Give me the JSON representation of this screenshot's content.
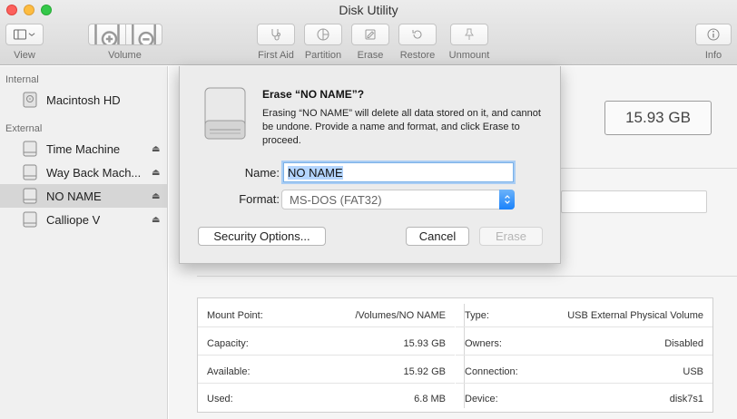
{
  "window": {
    "title": "Disk Utility"
  },
  "toolbar": {
    "view_label": "View",
    "volume_label": "Volume",
    "first_aid_label": "First Aid",
    "partition_label": "Partition",
    "erase_label": "Erase",
    "restore_label": "Restore",
    "unmount_label": "Unmount",
    "info_label": "Info"
  },
  "sidebar": {
    "sections": [
      {
        "heading": "Internal",
        "items": [
          {
            "label": "Macintosh HD",
            "eject": false
          }
        ]
      },
      {
        "heading": "External",
        "items": [
          {
            "label": "Time Machine",
            "eject": true
          },
          {
            "label": "Way Back Mach...",
            "eject": true
          },
          {
            "label": "NO NAME",
            "eject": true,
            "selected": true
          },
          {
            "label": "Calliope V",
            "eject": true
          }
        ]
      }
    ],
    "eject_glyph": "⏏"
  },
  "main": {
    "capacity": "15.93 GB",
    "info": {
      "left": [
        {
          "key": "Mount Point:",
          "value": "/Volumes/NO NAME"
        },
        {
          "key": "Capacity:",
          "value": "15.93 GB"
        },
        {
          "key": "Available:",
          "value": "15.92 GB"
        },
        {
          "key": "Used:",
          "value": "6.8 MB"
        }
      ],
      "right": [
        {
          "key": "Type:",
          "value": "USB External Physical Volume"
        },
        {
          "key": "Owners:",
          "value": "Disabled"
        },
        {
          "key": "Connection:",
          "value": "USB"
        },
        {
          "key": "Device:",
          "value": "disk7s1"
        }
      ]
    }
  },
  "dialog": {
    "title": "Erase “NO NAME”?",
    "message": "Erasing “NO NAME” will delete all data stored on it, and cannot be undone. Provide a name and format, and click Erase to proceed.",
    "name_label": "Name:",
    "name_value": "NO NAME",
    "format_label": "Format:",
    "format_value": "MS-DOS (FAT32)",
    "security_button": "Security Options...",
    "cancel_button": "Cancel",
    "erase_button": "Erase"
  },
  "colors": {
    "selection": "#b4d5fe",
    "focus_ring": "#a9cdf4",
    "accent": "#1a82fb"
  }
}
